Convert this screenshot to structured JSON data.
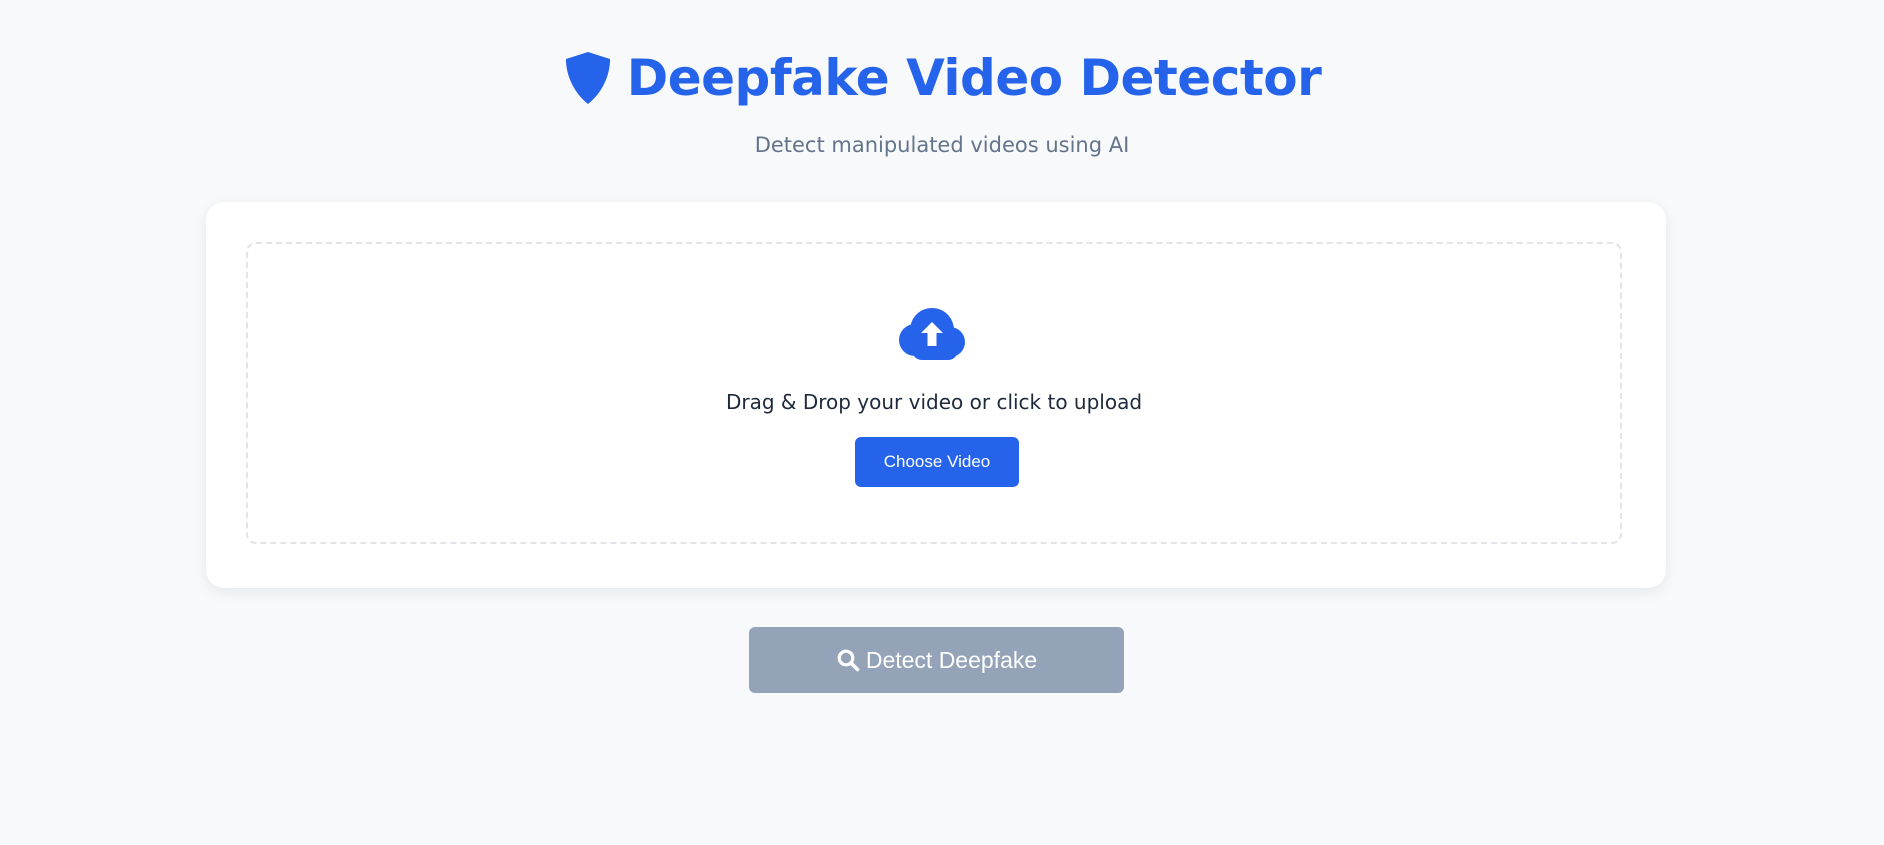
{
  "header": {
    "title": "Deepfake Video Detector",
    "subtitle": "Detect manipulated videos using AI",
    "icon": "shield-icon"
  },
  "upload": {
    "icon": "cloud-upload-icon",
    "prompt": "Drag & Drop your video or click to upload",
    "choose_label": "Choose Video"
  },
  "detect": {
    "icon": "search-icon",
    "label": "Detect Deepfake",
    "disabled": true
  },
  "colors": {
    "accent": "#2563eb",
    "disabled_button": "#94a3b8",
    "background": "#f8f9fb",
    "subtitle_text": "#64748b"
  }
}
